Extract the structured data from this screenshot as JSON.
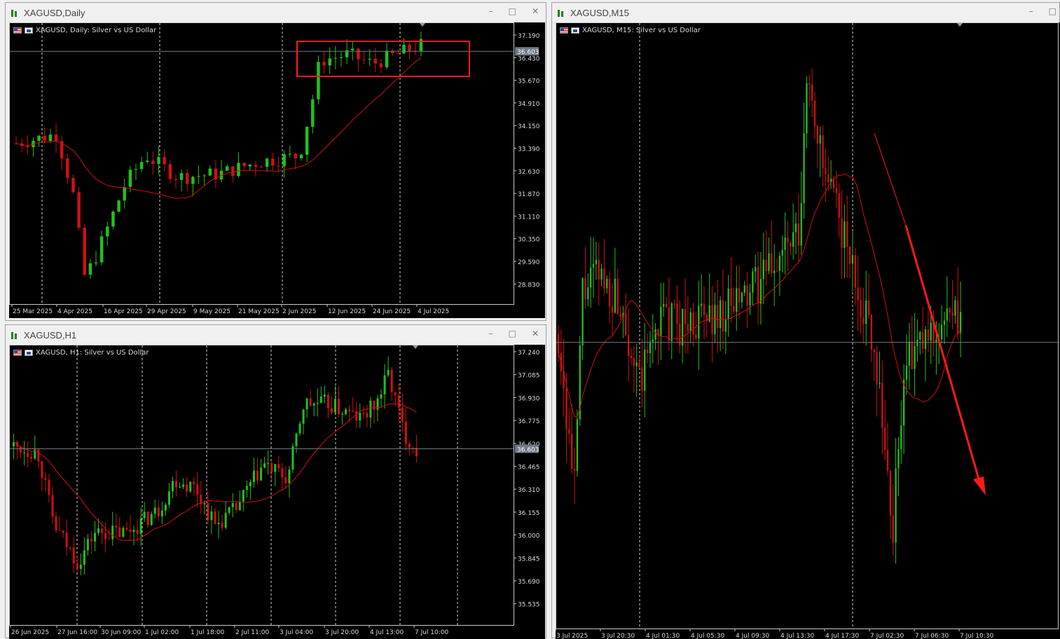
{
  "windows": {
    "daily": {
      "title": "XAGUSD,Daily",
      "label": "XAGUSD, Daily:  Silver vs US Dollar",
      "price_ticks": [
        "37.190",
        "36.430",
        "35.670",
        "34.910",
        "34.150",
        "33.390",
        "32.630",
        "31.870",
        "31.110",
        "30.350",
        "29.590",
        "28.830"
      ],
      "current_price": "36.603",
      "time_ticks": [
        "25 Mar 2025",
        "4 Apr 2025",
        "16 Apr 2025",
        "29 Apr 2025",
        "9 May 2025",
        "21 May 2025",
        "2 Jun 2025",
        "12 Jun 2025",
        "24 Jun 2025",
        "4 Jul 2025"
      ]
    },
    "h1": {
      "title": "XAGUSD,H1",
      "label": "XAGUSD, H1:  Silver vs US Dollar",
      "price_ticks": [
        "37.240",
        "37.085",
        "36.930",
        "36.775",
        "36.620",
        "36.465",
        "36.310",
        "36.155",
        "36.000",
        "35.845",
        "35.690",
        "35.535"
      ],
      "current_price": "36.603",
      "time_ticks": [
        "26 Jun 2025",
        "27 Jun 16:00",
        "30 Jun 09:00",
        "1 Jul 02:00",
        "1 Jul 18:00",
        "2 Jul 11:00",
        "3 Jul 04:00",
        "3 Jul 20:00",
        "4 Jul 13:00",
        "7 Jul 10:00"
      ]
    },
    "m15": {
      "title": "XAGUSD,M15",
      "label": "XAGUSD, M15:  Silver vs US Dollar",
      "time_ticks": [
        "3 Jul 2025",
        "3 Jul 20:30",
        "4 Jul 01:30",
        "4 Jul 05:30",
        "4 Jul 09:30",
        "4 Jul 13:30",
        "4 Jul 17:30",
        "7 Jul 02:30",
        "7 Jul 06:30",
        "7 Jul 10:30"
      ]
    }
  },
  "colors": {
    "background": "#000000",
    "bull": "#22c01a",
    "bear": "#d01010",
    "ma": "#d01010",
    "annotation": "#ff1a1a",
    "bid_line": "#6e7a88"
  },
  "window_buttons": {
    "minimize": "–",
    "maximize": "□",
    "close": "✕"
  }
}
